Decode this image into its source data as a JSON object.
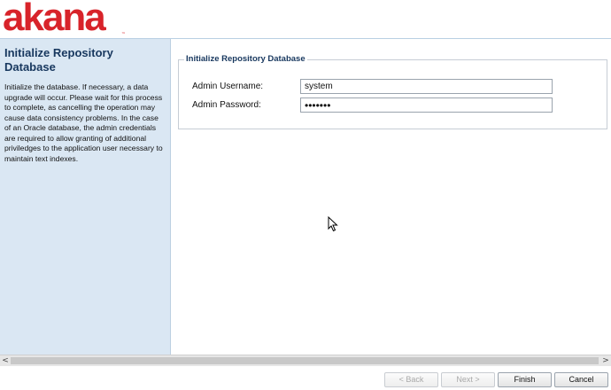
{
  "brand": {
    "name": "akana",
    "trademark": "™",
    "color": "#d8232a"
  },
  "sidebar": {
    "title": "Initialize Repository Database",
    "description": "Initialize the database. If necessary, a data upgrade will occur. Please wait for this process to complete, as cancelling the operation may cause data consistency problems. In the case of an Oracle database, the admin credentials are required to allow granting of additional priviledges to the application user necessary to maintain text indexes."
  },
  "form": {
    "legend": "Initialize Repository Database",
    "username_label": "Admin Username:",
    "username_value": "system",
    "password_label": "Admin Password:",
    "password_value": "•••••••"
  },
  "scrollbar": {
    "left_arrow": "<",
    "right_arrow": ">"
  },
  "buttons": {
    "back": "< Back",
    "next": "Next >",
    "finish": "Finish",
    "cancel": "Cancel"
  }
}
